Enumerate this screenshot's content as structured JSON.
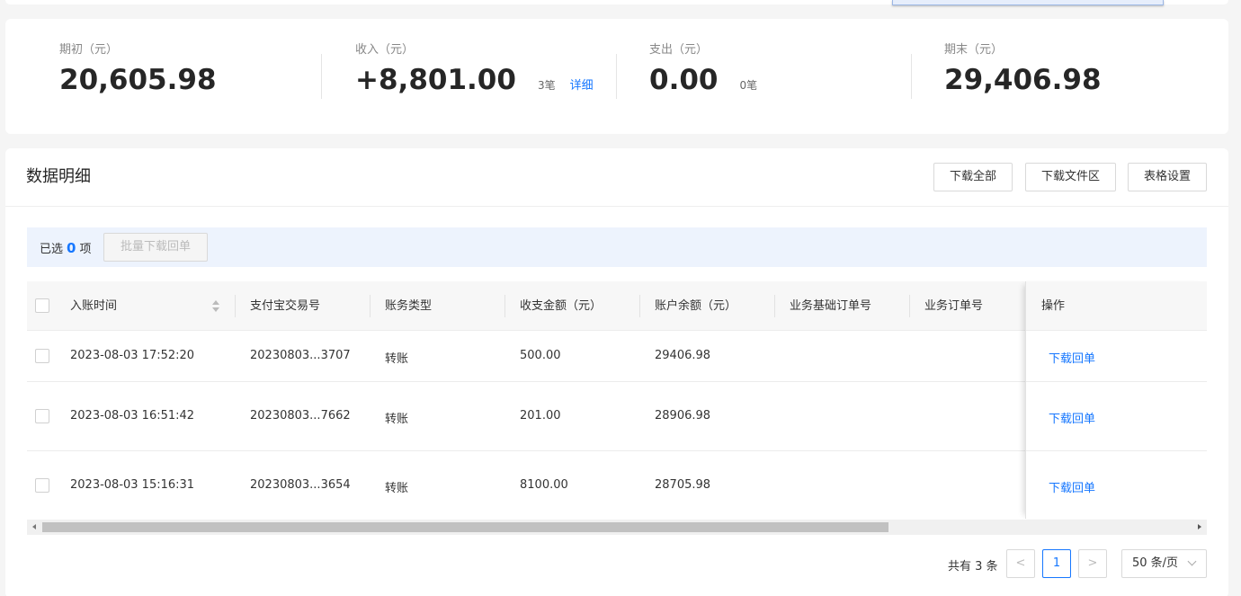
{
  "summary": [
    {
      "label": "期初（元）",
      "amount": "20,605.98",
      "count": "",
      "link": ""
    },
    {
      "label": "收入（元）",
      "amount": "+8,801.00",
      "count": "3笔",
      "link": "详细"
    },
    {
      "label": "支出（元）",
      "amount": "0.00",
      "count": "0笔",
      "link": ""
    },
    {
      "label": "期末（元）",
      "amount": "29,406.98",
      "count": "",
      "link": ""
    }
  ],
  "detail": {
    "title": "数据明细",
    "buttons": {
      "download_all": "下载全部",
      "download_files": "下载文件区",
      "table_settings": "表格设置"
    }
  },
  "selection": {
    "prefix": "已选",
    "count": "0",
    "suffix": "项",
    "batch_button": "批量下载回单"
  },
  "table": {
    "columns": [
      "入账时间",
      "支付宝交易号",
      "账务类型",
      "收支金额（元）",
      "账户余额（元）",
      "业务基础订单号",
      "业务订单号",
      "操作"
    ],
    "rows": [
      {
        "time": "2023-08-03 17:52:20",
        "trade_no": "20230803...3707",
        "type": "转账",
        "amount": "500.00",
        "balance": "29406.98",
        "base_order": "",
        "order": "",
        "action": "下载回单"
      },
      {
        "time": "2023-08-03 16:51:42",
        "trade_no": "20230803...7662",
        "type": "转账",
        "amount": "201.00",
        "balance": "28906.98",
        "base_order": "",
        "order": "",
        "action": "下载回单"
      },
      {
        "time": "2023-08-03 15:16:31",
        "trade_no": "20230803...3654",
        "type": "转账",
        "amount": "8100.00",
        "balance": "28705.98",
        "base_order": "",
        "order": "",
        "action": "下载回单"
      }
    ]
  },
  "pagination": {
    "total": "共有 3 条",
    "prev": "<",
    "current": "1",
    "next": ">",
    "page_size": "50 条/页"
  },
  "colors": {
    "accent": "#1677ff",
    "selection_bg": "#edf3fd"
  }
}
